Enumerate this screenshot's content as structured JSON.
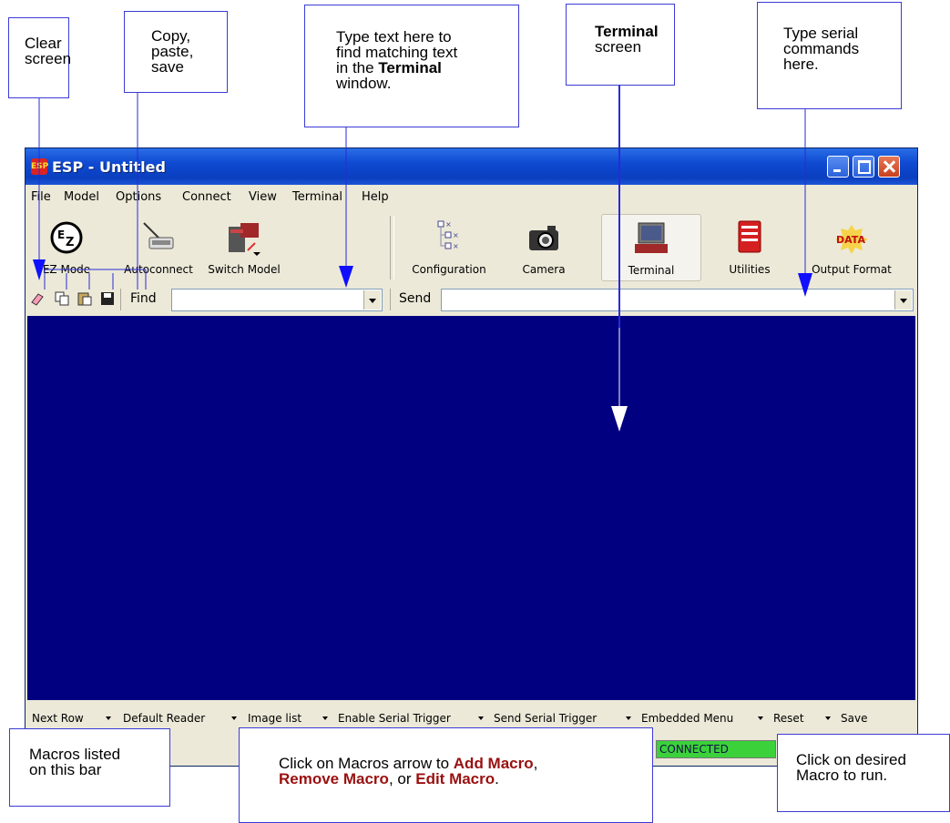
{
  "window": {
    "title": "ESP - Untitled",
    "app_icon": "ESP"
  },
  "menu": [
    "File",
    "Model",
    "Options",
    "Connect",
    "View",
    "Terminal",
    "Help"
  ],
  "toolbar": {
    "ez_mode": "EZ Mode",
    "autoconnect": "Autoconnect",
    "switch_model": "Switch Model",
    "configuration": "Configuration",
    "camera": "Camera",
    "terminal": "Terminal",
    "utilities": "Utilities",
    "output_format": "Output Format"
  },
  "findbar": {
    "find_label": "Find",
    "find_value": "",
    "send_label": "Send",
    "send_value": ""
  },
  "macros": [
    "Next Row",
    "Default Reader",
    "Image list",
    "Enable Serial Trigger",
    "Send Serial Trigger",
    "Embedded Menu",
    "Reset",
    "Save"
  ],
  "status": {
    "connected": "CONNECTED"
  },
  "callouts": {
    "clear_screen": [
      "Clear",
      "screen"
    ],
    "copy_paste_save": [
      "Copy,",
      "paste,",
      "save"
    ],
    "find_text": [
      "Type text here to",
      "find matching text",
      "in the "
    ],
    "find_text_bold": "Terminal",
    "find_text_end": "window.",
    "terminal_bold": "Terminal",
    "terminal_rest": "screen",
    "serial_commands": [
      "Type serial",
      "commands",
      "here."
    ],
    "macros_bar": [
      "Macros listed",
      "on this bar"
    ],
    "macros_arrow_pre": "Click on Macros arrow to ",
    "macros_add": "Add Macro",
    "macros_comma": ",",
    "macros_remove": "Remove Macro",
    "macros_or": ", or ",
    "macros_edit": "Edit Macro",
    "macros_period": ".",
    "run_macro": [
      "Click on desired",
      "Macro to run."
    ]
  },
  "colors": {
    "terminal_bg": "#000080",
    "connected": "#3bd13b",
    "callout_border": "#3b3bd6",
    "highlight": "#9a1010"
  }
}
